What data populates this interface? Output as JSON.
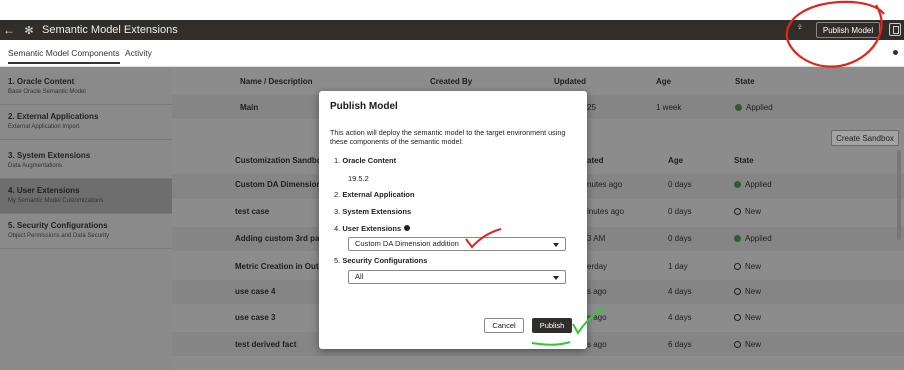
{
  "topbar": {
    "title": "Semantic Model Extensions",
    "publish_label": "Publish Model"
  },
  "tabs": [
    {
      "label": "Semantic Model Components"
    },
    {
      "label": "Activity"
    }
  ],
  "sidebar": {
    "items": [
      {
        "title": "1. Oracle Content",
        "sub": "Base Oracle Semantic Model"
      },
      {
        "title": "2. External Applications",
        "sub": "External Application Import"
      },
      {
        "title": "3. System Extensions",
        "sub": "Data Augmentations"
      },
      {
        "title": "4. User Extensions",
        "sub": "My Semantic Model Customizations"
      },
      {
        "title": "5. Security Configurations",
        "sub": "Object Permissions and Data Security"
      }
    ]
  },
  "main_table": {
    "headers": {
      "name": "Name / Description",
      "created": "Created By",
      "updated": "Updated",
      "age": "Age",
      "state": "State"
    },
    "row": {
      "name": "Main",
      "updated": "25",
      "age": "1 week",
      "state": "Applied"
    }
  },
  "sandbox": {
    "create_label": "Create Sandbox",
    "headers": {
      "name": "Customization Sandbo",
      "updated": "ated",
      "age": "Age",
      "state": "State"
    },
    "rows": [
      {
        "name": "Custom DA Dimension",
        "updated": "nutes ago",
        "age": "0 days",
        "state": "Applied"
      },
      {
        "name": "test case",
        "updated": "inutes ago",
        "age": "0 days",
        "state": "New"
      },
      {
        "name": "Adding custom 3rd par",
        "updated": "3 AM",
        "age": "0 days",
        "state": "Applied"
      },
      {
        "name": "Metric Creation in Out",
        "updated": "erday",
        "age": "1 day",
        "state": "New"
      },
      {
        "name": "use case 4",
        "updated": "s ago",
        "age": "4 days",
        "state": "New"
      },
      {
        "name": "use case 3",
        "updated": "s ago",
        "age": "4 days",
        "state": "New"
      },
      {
        "name": "test derived fact",
        "updated": "s ago",
        "age": "6 days",
        "state": "New"
      }
    ]
  },
  "modal": {
    "title": "Publish Model",
    "description": "This action will deploy the semantic model to the target environment using these components of the semantic model:",
    "items": {
      "oracle_num": "1.",
      "oracle_label": "Oracle Content",
      "oracle_version": "19.5.2",
      "ext_num": "2.",
      "ext_label": "External Application",
      "sys_num": "3.",
      "sys_label": "System Extensions",
      "user_num": "4.",
      "user_label": "User Extensions",
      "user_value": "Custom DA Dimension addition",
      "sec_num": "5.",
      "sec_label": "Security Configurations",
      "sec_value": "All"
    },
    "cancel_label": "Cancel",
    "publish_label": "Publish"
  },
  "colors": {
    "topbar": "#312d2a",
    "annotation_red": "#e0261c",
    "annotation_green": "#2ecc2e"
  }
}
